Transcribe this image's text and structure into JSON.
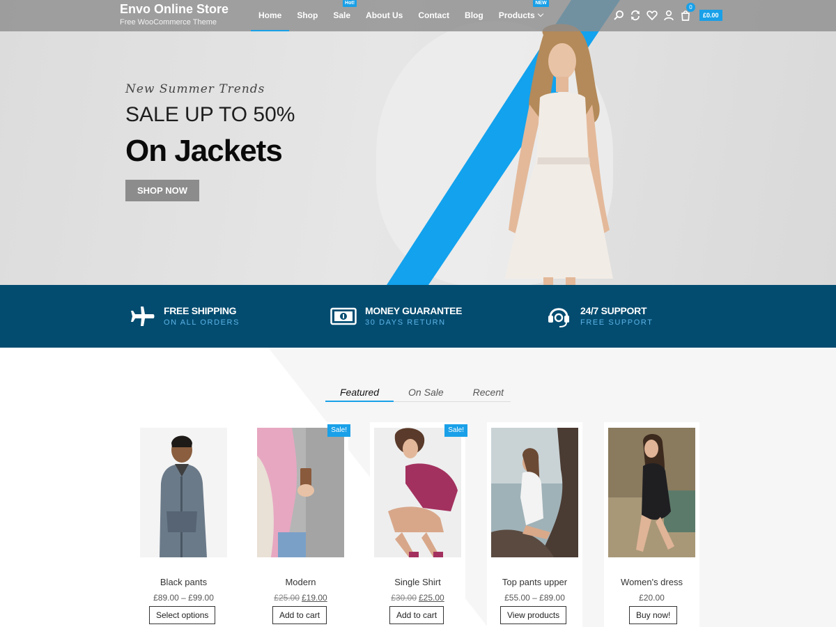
{
  "header": {
    "site_title": "Envo Online Store",
    "tagline": "Free WooCommerce Theme",
    "nav": [
      {
        "label": "Home"
      },
      {
        "label": "Shop"
      },
      {
        "label": "Sale",
        "badge": "Hot!"
      },
      {
        "label": "About Us"
      },
      {
        "label": "Contact"
      },
      {
        "label": "Blog"
      },
      {
        "label": "Products",
        "badge": "NEW"
      }
    ],
    "tools": [
      "search-icon",
      "compare-icon",
      "heart-icon",
      "user-icon",
      "cart-icon"
    ],
    "cart_count": "0",
    "cart_total": "£0.00"
  },
  "hero": {
    "kicker": "New Summer Trends",
    "subtitle": "SALE UP TO 50%",
    "title": "On Jackets",
    "button": "SHOP NOW"
  },
  "features": [
    {
      "icon": "plane-icon",
      "title": "FREE SHIPPING",
      "subtitle": "ON ALL ORDERS"
    },
    {
      "icon": "money-icon",
      "title": "MONEY GUARANTEE",
      "subtitle": "30 DAYS RETURN"
    },
    {
      "icon": "headset-icon",
      "title": "24/7 SUPPORT",
      "subtitle": "FREE SUPPORT"
    }
  ],
  "tabs": [
    {
      "label": "Featured"
    },
    {
      "label": "On Sale"
    },
    {
      "label": "Recent"
    }
  ],
  "products": [
    {
      "name": "Black pants",
      "price": "£89.00 – £99.00",
      "button": "Select options"
    },
    {
      "name": "Modern",
      "badge": "Sale!",
      "old_price": "£25.00",
      "new_price": "£19.00",
      "button": "Add to cart"
    },
    {
      "name": "Single Shirt",
      "badge": "Sale!",
      "old_price": "£30.00",
      "new_price": "£25.00",
      "button": "Add to cart"
    },
    {
      "name": "Top pants upper",
      "price": "£55.00 – £89.00",
      "button": "View products"
    },
    {
      "name": "Women's dress",
      "price": "£20.00",
      "button": "Buy now!"
    }
  ],
  "colors": {
    "accent": "#19a0e8",
    "feature_bar": "#034c70",
    "header_overlay": "#8c8c8c"
  }
}
